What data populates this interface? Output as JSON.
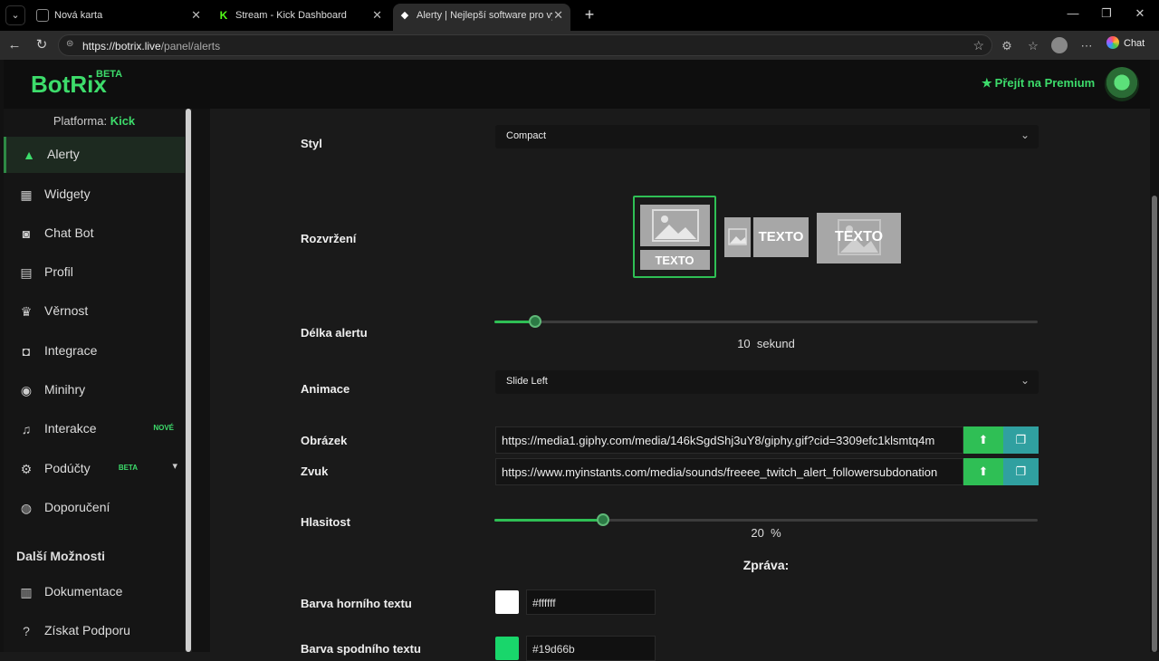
{
  "browser": {
    "tabs": [
      {
        "title": "Nová karta",
        "favicon_color": "#444"
      },
      {
        "title": "Stream - Kick Dashboard",
        "favicon_color": "#53fc18"
      },
      {
        "title": "Alerty | Nejlepší software pro vylep",
        "favicon_color": "#ffffff"
      }
    ],
    "url_host": "https://botrix.live",
    "url_path": "/panel/alerts",
    "chat_label": "Chat"
  },
  "app": {
    "logo": "BotRix",
    "logo_badge": "BETA",
    "premium_label": "Přejít na Premium",
    "accent": "#3ddc6b"
  },
  "sidebar": {
    "platform_label": "Platforma:",
    "platform_value": "Kick",
    "items": [
      {
        "label": "Alerty",
        "icon": "warning-icon"
      },
      {
        "label": "Widgety",
        "icon": "grid-icon"
      },
      {
        "label": "Chat Bot",
        "icon": "robot-icon"
      },
      {
        "label": "Profil",
        "icon": "id-card-icon"
      },
      {
        "label": "Věrnost",
        "icon": "trophy-icon"
      },
      {
        "label": "Integrace",
        "icon": "discord-icon"
      },
      {
        "label": "Minihry",
        "icon": "gamepad-icon"
      },
      {
        "label": "Interakce",
        "icon": "music-icon",
        "badge": "NOVÉ"
      },
      {
        "label": "Podúčty",
        "icon": "user-gear-icon",
        "badge": "BETA"
      },
      {
        "label": "Doporučení",
        "icon": "users-icon"
      }
    ],
    "more_title": "Další Možnosti",
    "more_items": [
      {
        "label": "Dokumentace",
        "icon": "book-icon"
      },
      {
        "label": "Získat Podporu",
        "icon": "help-icon"
      }
    ]
  },
  "form": {
    "style_label": "Styl",
    "style_value": "Compact",
    "layout_label": "Rozvržení",
    "layout_text": "TEXTO",
    "duration_label": "Délka alertu",
    "duration_value": "10",
    "duration_unit": "sekund",
    "duration_fraction": 0.075,
    "animation_label": "Animace",
    "animation_value": "Slide Left",
    "image_label": "Obrázek",
    "image_url": "https://media1.giphy.com/media/146kSgdShj3uY8/giphy.gif?cid=3309efc1klsmtq4m",
    "sound_label": "Zvuk",
    "sound_url": "https://www.myinstants.com/media/sounds/freeee_twitch_alert_followersubdonation",
    "volume_label": "Hlasitost",
    "volume_value": "20",
    "volume_unit": "%",
    "volume_fraction": 0.2,
    "message_heading": "Zpráva:",
    "top_color_label": "Barva horního textu",
    "top_color_value": "#ffffff",
    "bottom_color_label": "Barva spodního textu",
    "bottom_color_value": "#19d66b"
  }
}
